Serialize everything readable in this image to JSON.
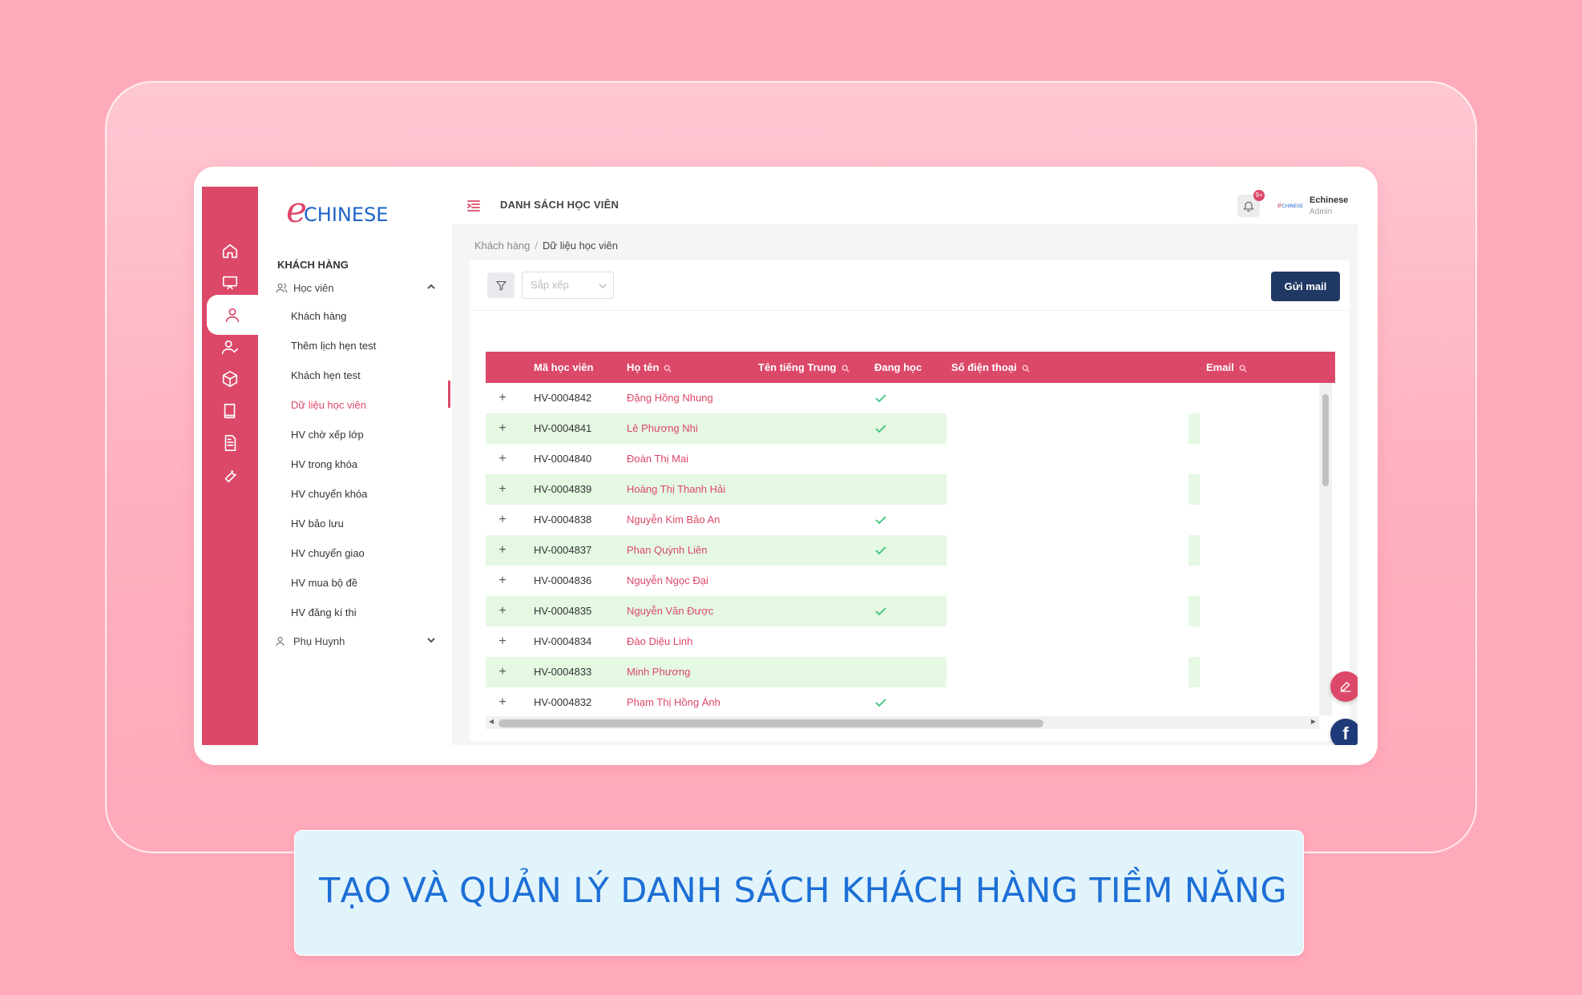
{
  "caption": "TẠO VÀ QUẢN LÝ DANH SÁCH KHÁCH HÀNG TIỀM NĂNG",
  "brand": {
    "logo_e": "e",
    "logo_text": "CHINESE"
  },
  "rail": {
    "items": [
      {
        "name": "home-icon"
      },
      {
        "name": "presentation-icon"
      },
      {
        "name": "user-icon",
        "active": true
      },
      {
        "name": "user-check-icon"
      },
      {
        "name": "box-icon"
      },
      {
        "name": "book-icon"
      },
      {
        "name": "document-icon"
      },
      {
        "name": "wrench-icon"
      }
    ]
  },
  "menu": {
    "heading": "KHÁCH HÀNG",
    "group_students": "Học viên",
    "items": [
      "Khách hàng",
      "Thêm lịch hẹn test",
      "Khách hẹn test",
      "Dữ liệu học viên",
      "HV chờ xếp lớp",
      "HV trong khóa",
      "HV chuyển khóa",
      "HV bảo lưu",
      "HV chuyển giao",
      "HV mua bộ đề",
      "HV đăng kí thi"
    ],
    "active_item": "Dữ liệu học viên",
    "group_parents": "Phụ Huynh"
  },
  "header": {
    "title": "DANH SÁCH HỌC VIÊN",
    "notification_badge": "9+",
    "user_name": "Echinese",
    "user_role": "Admin"
  },
  "breadcrumb": {
    "root": "Khách hàng",
    "separator": "/",
    "current": "Dữ liệu học viên"
  },
  "toolbar": {
    "sort_placeholder": "Sắp xếp",
    "send_mail_label": "Gửi mail"
  },
  "table": {
    "columns": [
      "Mã học viên",
      "Họ tên",
      "Tên tiếng Trung",
      "Đang học",
      "Số điện thoại",
      "Email"
    ],
    "rows": [
      {
        "id": "HV-0004842",
        "name": "Đặng Hồng Nhung",
        "studying": true,
        "highlight": false
      },
      {
        "id": "HV-0004841",
        "name": "Lê Phương Nhi",
        "studying": true,
        "highlight": true
      },
      {
        "id": "HV-0004840",
        "name": "Đoàn Thị Mai",
        "studying": false,
        "highlight": false
      },
      {
        "id": "HV-0004839",
        "name": "Hoàng Thị Thanh Hải",
        "studying": false,
        "highlight": true
      },
      {
        "id": "HV-0004838",
        "name": "Nguyễn Kim Bảo An",
        "studying": true,
        "highlight": false
      },
      {
        "id": "HV-0004837",
        "name": "Phan Quỳnh Liên",
        "studying": true,
        "highlight": true
      },
      {
        "id": "HV-0004836",
        "name": "Nguyễn Ngọc Đại",
        "studying": false,
        "highlight": false
      },
      {
        "id": "HV-0004835",
        "name": "Nguyễn Văn Được",
        "studying": true,
        "highlight": true
      },
      {
        "id": "HV-0004834",
        "name": "Đào Diệu Linh",
        "studying": false,
        "highlight": false
      },
      {
        "id": "HV-0004833",
        "name": "Minh Phương",
        "studying": false,
        "highlight": true
      },
      {
        "id": "HV-0004832",
        "name": "Phạm Thị Hồng Ánh",
        "studying": true,
        "highlight": false
      }
    ],
    "expand_symbol": "+"
  },
  "colors": {
    "primary": "#dc4868",
    "navy": "#1f3864",
    "caption_text": "#1d6fd6",
    "page_bg": "#ffaabb"
  }
}
